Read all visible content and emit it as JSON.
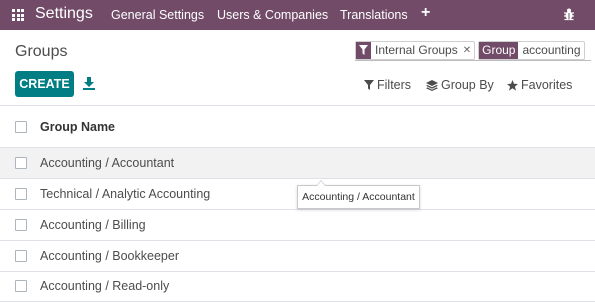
{
  "navbar": {
    "app_name": "Settings",
    "menu": [
      "General Settings",
      "Users & Companies",
      "Translations"
    ],
    "plus_icon": "plus-icon",
    "debug_icon": "bug-icon",
    "background": "#714b67"
  },
  "page": {
    "title": "Groups"
  },
  "search": {
    "facets": [
      {
        "icon": "filter-icon",
        "value": "Internal Groups"
      },
      {
        "label": "Group",
        "value": "accounting"
      }
    ]
  },
  "toolbar": {
    "create_label": "CREATE",
    "download_icon": "download-icon",
    "filters_label": "Filters",
    "group_by_label": "Group By",
    "favorites_label": "Favorites",
    "accent": "#017e84"
  },
  "table": {
    "header": "Group Name",
    "rows": [
      "Accounting / Accountant",
      "Technical / Analytic Accounting",
      "Accounting / Billing",
      "Accounting / Bookkeeper",
      "Accounting / Read-only"
    ]
  },
  "tooltip": {
    "text": "Accounting / Accountant"
  }
}
